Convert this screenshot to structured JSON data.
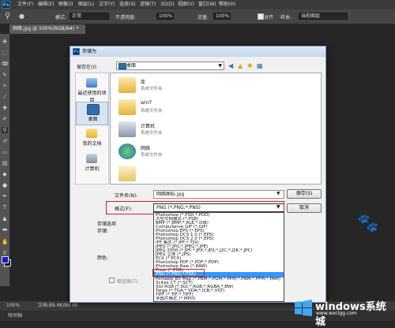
{
  "menubar": {
    "logo": "Ps",
    "items": [
      "文件(F)",
      "编辑(E)",
      "图像(I)",
      "图层(L)",
      "文字(Y)",
      "选择(S)",
      "滤镜(T)",
      "3D(D)",
      "视图(V)",
      "窗口(W)",
      "帮助(H)"
    ]
  },
  "options": {
    "mode_label": "模式:",
    "mode_value": "正常",
    "opacity_label": "不透明度:",
    "opacity_value": "100%",
    "flow_label": "流量:",
    "flow_value": "100%",
    "align_label": "对齐",
    "sample_label": "样本:",
    "sample_value": "当前图层"
  },
  "doc_tab": "网络.jpg @ 100%(RGB/8#) *",
  "status": {
    "zoom": "100%",
    "doc": "文档:89.4K/89.4K"
  },
  "timeline": "时间轴",
  "dialog": {
    "title": "存储为",
    "save_in_label": "保存在(I):",
    "location": "桌面",
    "places": [
      "最近使用的项目",
      "桌面",
      "我的文档",
      "计算机"
    ],
    "files": [
      {
        "name": "库",
        "sub": "系统文件夹"
      },
      {
        "name": "win7",
        "sub": "系统文件夹"
      },
      {
        "name": "计算机",
        "sub": "系统文件夹"
      },
      {
        "name": "网络",
        "sub": "系统文件夹"
      },
      {
        "name": "",
        "sub": ""
      }
    ],
    "filename_label": "文件名(N):",
    "filename_value": "网络图标.jpg",
    "format_label": "格式(F):",
    "format_value": "PNG (*.PNG;*.PNS)",
    "save_button": "保存(S)",
    "cancel_button": "取消",
    "save_options_label": "存储选项",
    "store_label": "存储:",
    "color_label": "颜色:",
    "thumbnail_label": "缩览图(T)",
    "format_options": [
      "Photoshop (*.PSD;*.PDD)",
      "大型文档格式 (*.PSB)",
      "BMP (*.BMP;*.RLE;*.DIB)",
      "CompuServe GIF (*.GIF)",
      "Photoshop EPS (*.EPS)",
      "Photoshop DCS 1.0 (*.EPS)",
      "Photoshop DCS 2.0 (*.EPS)",
      "IFF 格式 (*.IFF;*.TDI)",
      "JPEG (*.JPG;*.JPEG;*.JPE)",
      "JPEG 2000 (*.JPF;*.JPX;*.JP2;*.J2C;*.J2K;*.JPC)",
      "JPEG 立体 (*.JPS)",
      "PCX (*.PCX)",
      "Photoshop PDF (*.PDF;*.PDP)",
      "Photoshop Raw (*.RAW)",
      "Pixar (*.PXR)",
      "PNG (*.PNG;*.PNS)",
      "Portable Bit Map (*.PBM;*.PGM;*.PPM;*.PNM;*.PFM;*.PAM)",
      "Scitex CT (*.SCT)",
      "SGI RGB (*.SGI;*.RGB;*.RGBA;*.BW)",
      "Targa (*.TGA;*.VDA;*.ICB;*.VST)",
      "TIFF (*.TIF;*.TIFF)",
      "多图片格式 (*.MPO)"
    ],
    "selected_index": 15
  },
  "watermark": {
    "title": "windows系统城",
    "url": "www.wxclgg.com"
  },
  "colors": {
    "accent_red": "#d62020",
    "selection_blue": "#3399ff",
    "fg_color": "#1818d8"
  }
}
